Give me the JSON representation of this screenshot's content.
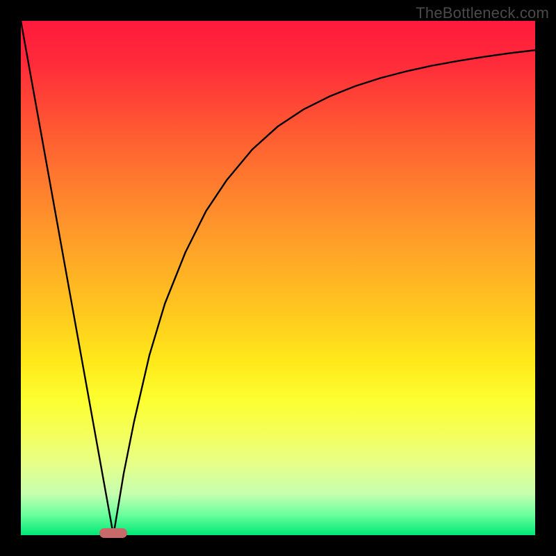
{
  "watermark": "TheBottleneck.com",
  "colors": {
    "frame": "#000000",
    "curve": "#000000",
    "marker": "#c86a6a"
  },
  "chart_data": {
    "type": "line",
    "title": "",
    "xlabel": "",
    "ylabel": "",
    "xlim": [
      0,
      100
    ],
    "ylim": [
      0,
      100
    ],
    "grid": false,
    "legend": false,
    "marker_x": 18,
    "series": [
      {
        "name": "left-line",
        "x": [
          0,
          18
        ],
        "y": [
          100,
          0
        ]
      },
      {
        "name": "right-curve",
        "x": [
          18,
          20,
          22,
          25,
          28,
          32,
          36,
          40,
          45,
          50,
          55,
          60,
          65,
          70,
          75,
          80,
          85,
          90,
          95,
          100
        ],
        "y": [
          0,
          12,
          22,
          35,
          45,
          55,
          63,
          69,
          75,
          79.5,
          82.8,
          85.3,
          87.3,
          88.9,
          90.2,
          91.3,
          92.2,
          93,
          93.7,
          94.3
        ]
      }
    ],
    "background_gradient": {
      "top": "#ff1a3c",
      "mid": "#fff020",
      "bottom": "#00e874"
    }
  }
}
